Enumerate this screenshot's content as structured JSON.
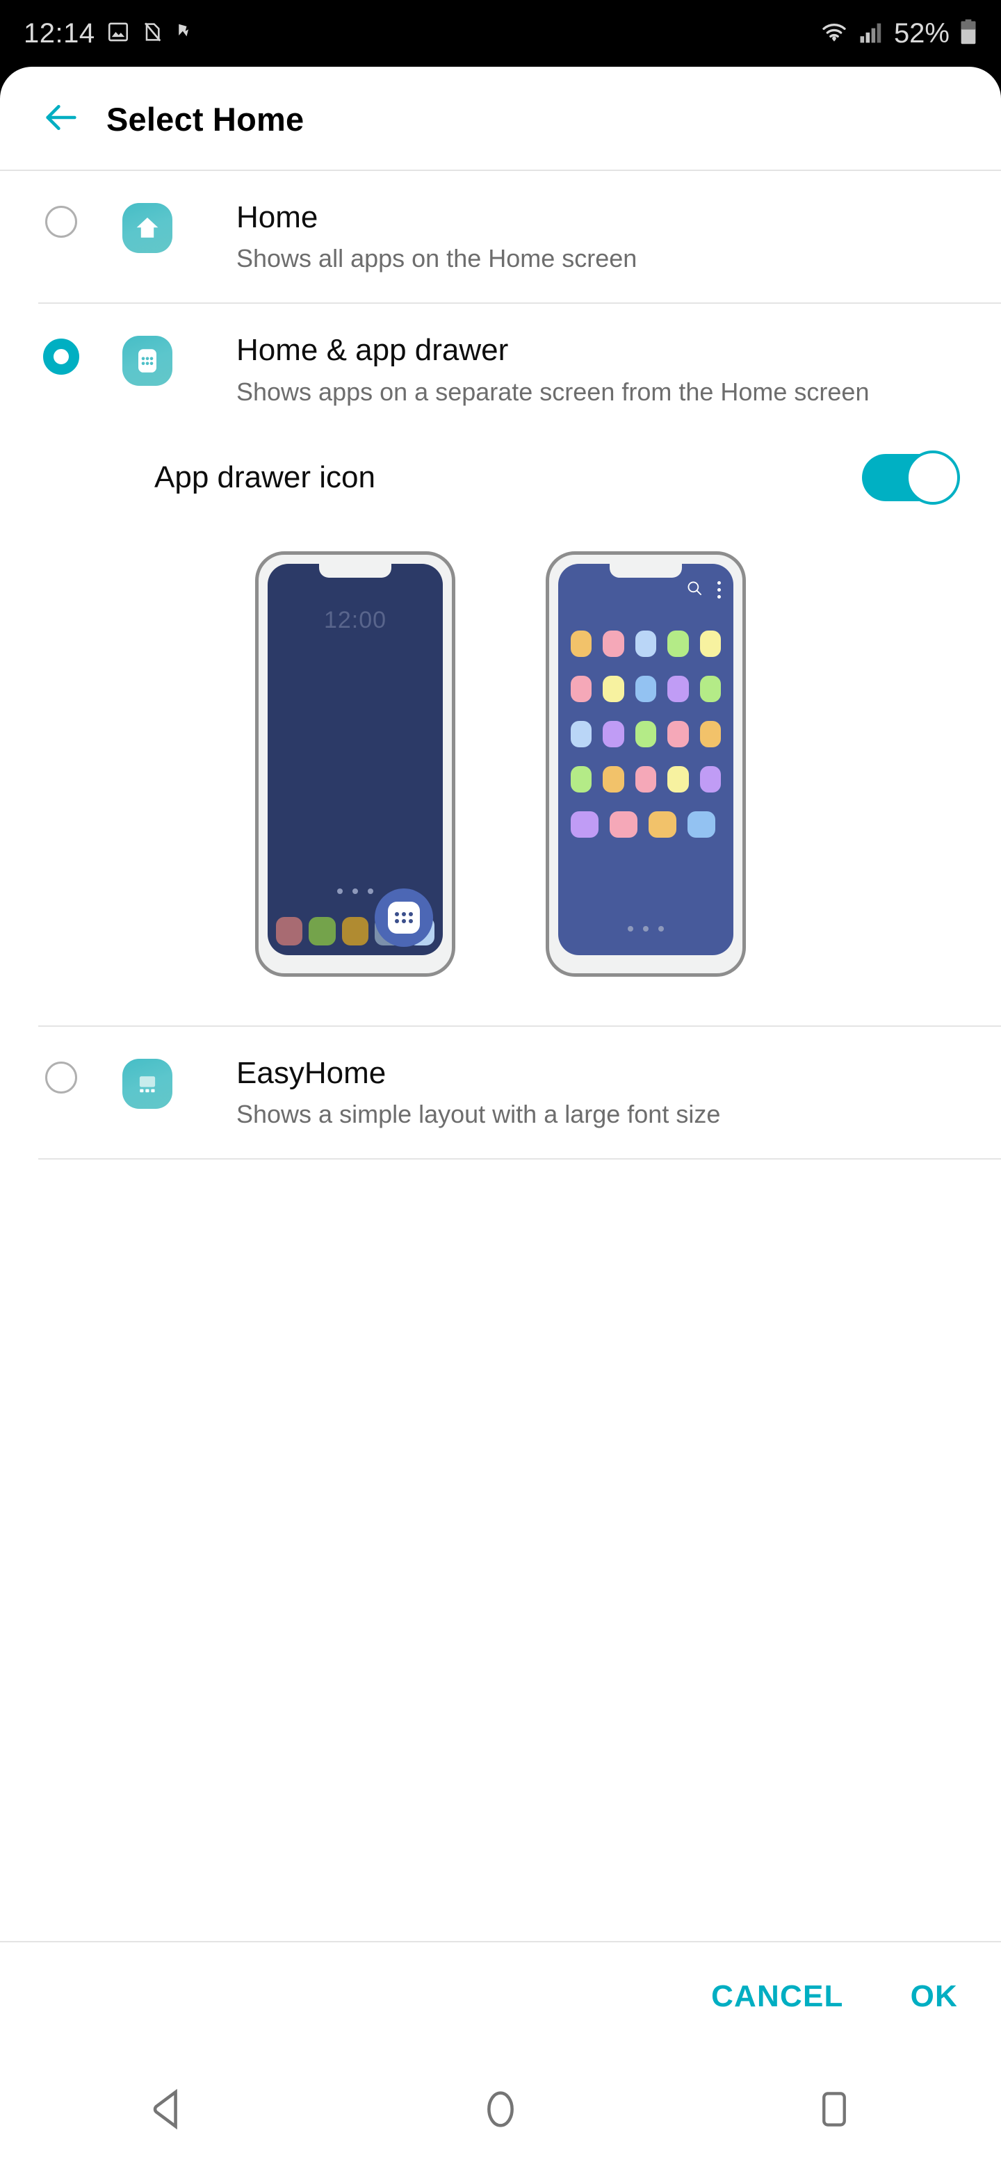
{
  "statusbar": {
    "time": "12:14",
    "battery_percent": "52%",
    "icons": [
      "image-icon",
      "no-sim-icon",
      "checkmark-flag-icon",
      "wifi-icon",
      "signal-icon",
      "battery-icon"
    ]
  },
  "header": {
    "title": "Select Home",
    "back_icon": "back-arrow-icon"
  },
  "options": [
    {
      "title": "Home",
      "subtitle": "Shows all apps on the Home screen",
      "selected": false,
      "icon": "home-launcher-icon"
    },
    {
      "title": "Home & app drawer",
      "subtitle": "Shows apps on a separate screen from the Home screen",
      "selected": true,
      "icon": "app-drawer-launcher-icon"
    },
    {
      "title": "EasyHome",
      "subtitle": "Shows a simple layout with a large font size",
      "selected": false,
      "icon": "easyhome-launcher-icon"
    }
  ],
  "drawer_setting": {
    "label": "App drawer icon",
    "toggle_on": true
  },
  "previews": {
    "home_phone": {
      "clock": "12:00",
      "page_dots": 3,
      "dock_tiles": [
        "#a86b72",
        "#74a34b",
        "#b08b31",
        "#7b90ab",
        "#b6d3f2"
      ],
      "drawer_button_icon": "app-drawer-icon"
    },
    "drawer_phone": {
      "search_icon": "search-icon",
      "menu_icon": "more-vertical-icon",
      "page_dots": 3,
      "app_rows": [
        [
          "#f2c26a",
          "#f5a8b8",
          "#bad6f7",
          "#b4eb87",
          "#f7f2a0"
        ],
        [
          "#f5a8b8",
          "#f7f2a0",
          "#93c2f2",
          "#c09cf5",
          "#b4eb87"
        ],
        [
          "#bad6f7",
          "#c09cf5",
          "#b4eb87",
          "#f5a8b8",
          "#f2c26a"
        ],
        [
          "#b4eb87",
          "#f2c26a",
          "#f5a8b8",
          "#f7f2a0",
          "#c09cf5"
        ],
        [
          "#c09cf5",
          "#f5a8b8",
          "#f2c26a",
          "#93c2f2"
        ]
      ]
    }
  },
  "buttons": {
    "cancel": "CANCEL",
    "ok": "OK"
  },
  "navbar": {
    "back": "nav-back-icon",
    "home": "nav-home-icon",
    "recents": "nav-recents-icon"
  },
  "colors": {
    "accent": "#00aec2",
    "icon_teal": "#4fc0c7",
    "text_primary": "#0d0d0d",
    "text_secondary": "#6d6d6d"
  }
}
